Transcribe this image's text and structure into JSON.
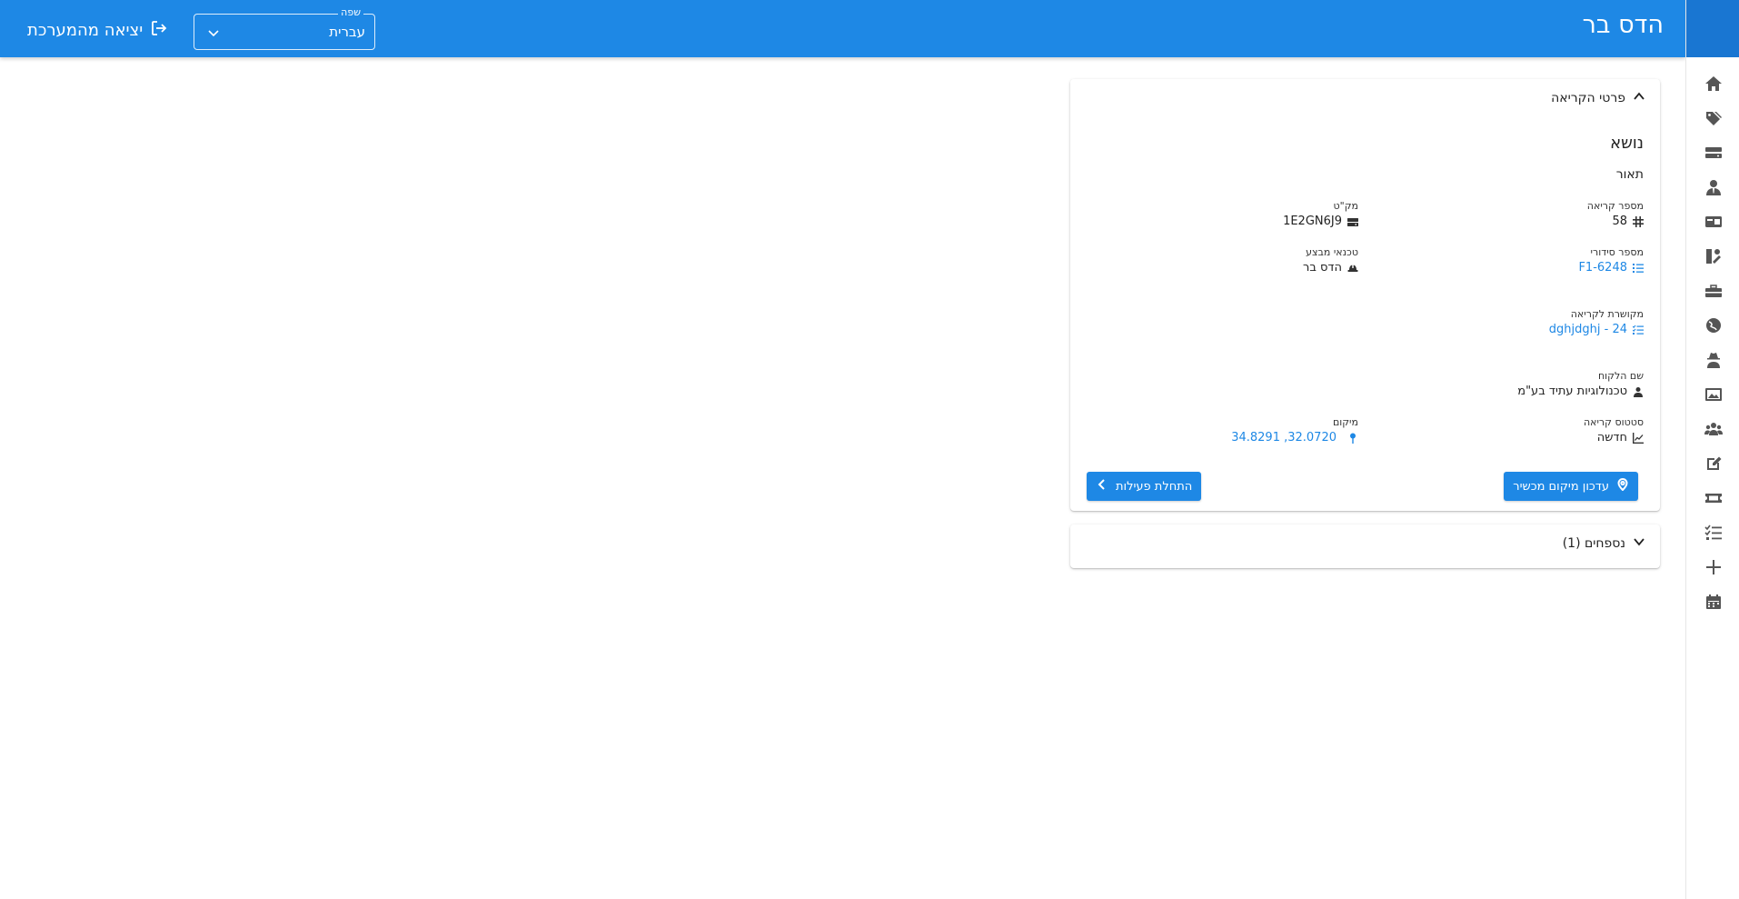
{
  "header": {
    "title": "הדס בר",
    "language_label": "שפה",
    "language_value": "עברית",
    "logout_label": "יציאה מהמערכת"
  },
  "sidebar": {
    "items": [
      {
        "icon": "home-icon"
      },
      {
        "icon": "tags-icon"
      },
      {
        "icon": "server-icon"
      },
      {
        "icon": "user-tie-icon"
      },
      {
        "icon": "id-card-icon"
      },
      {
        "icon": "tools-icon"
      },
      {
        "icon": "toolbox-icon"
      },
      {
        "icon": "globe-icon"
      },
      {
        "icon": "user-secret-icon"
      },
      {
        "icon": "image-gallery-icon"
      },
      {
        "icon": "users-icon"
      },
      {
        "icon": "edit-icon"
      },
      {
        "icon": "ticket-icon"
      },
      {
        "icon": "task-list-icon"
      },
      {
        "icon": "plus-icon"
      },
      {
        "icon": "calendar-icon"
      }
    ]
  },
  "call": {
    "panel_title": "פרטי הקריאה",
    "subject": "נושא",
    "description": "תאור",
    "fields": {
      "call_number": {
        "label": "מספר קריאה",
        "value": "58"
      },
      "sku": {
        "label": "מק\"ט",
        "value": "1E2GN6J9"
      },
      "serial": {
        "label": "מספר סידורי",
        "value": "6248-F1"
      },
      "technician": {
        "label": "טכנאי מבצע",
        "value": "הדס בר"
      },
      "related": {
        "label": "מקושרת לקריאה",
        "value": "24 - dghjdghj"
      },
      "customer": {
        "label": "שם הלקוח",
        "value": "טכנולוגיות עתיד בע\"מ"
      },
      "status": {
        "label": "סטטוס קריאה",
        "value": "חדשה"
      },
      "location": {
        "label": "מיקום",
        "value": "32.0720, 34.8291"
      }
    },
    "update_location_button": "עדכון מיקום מכשיר",
    "start_activity_button": "התחלת פעילות"
  },
  "attachments": {
    "title": "נספחים (1)"
  },
  "colors": {
    "primary": "#1e88e5",
    "rail_top": "#1976d2"
  }
}
